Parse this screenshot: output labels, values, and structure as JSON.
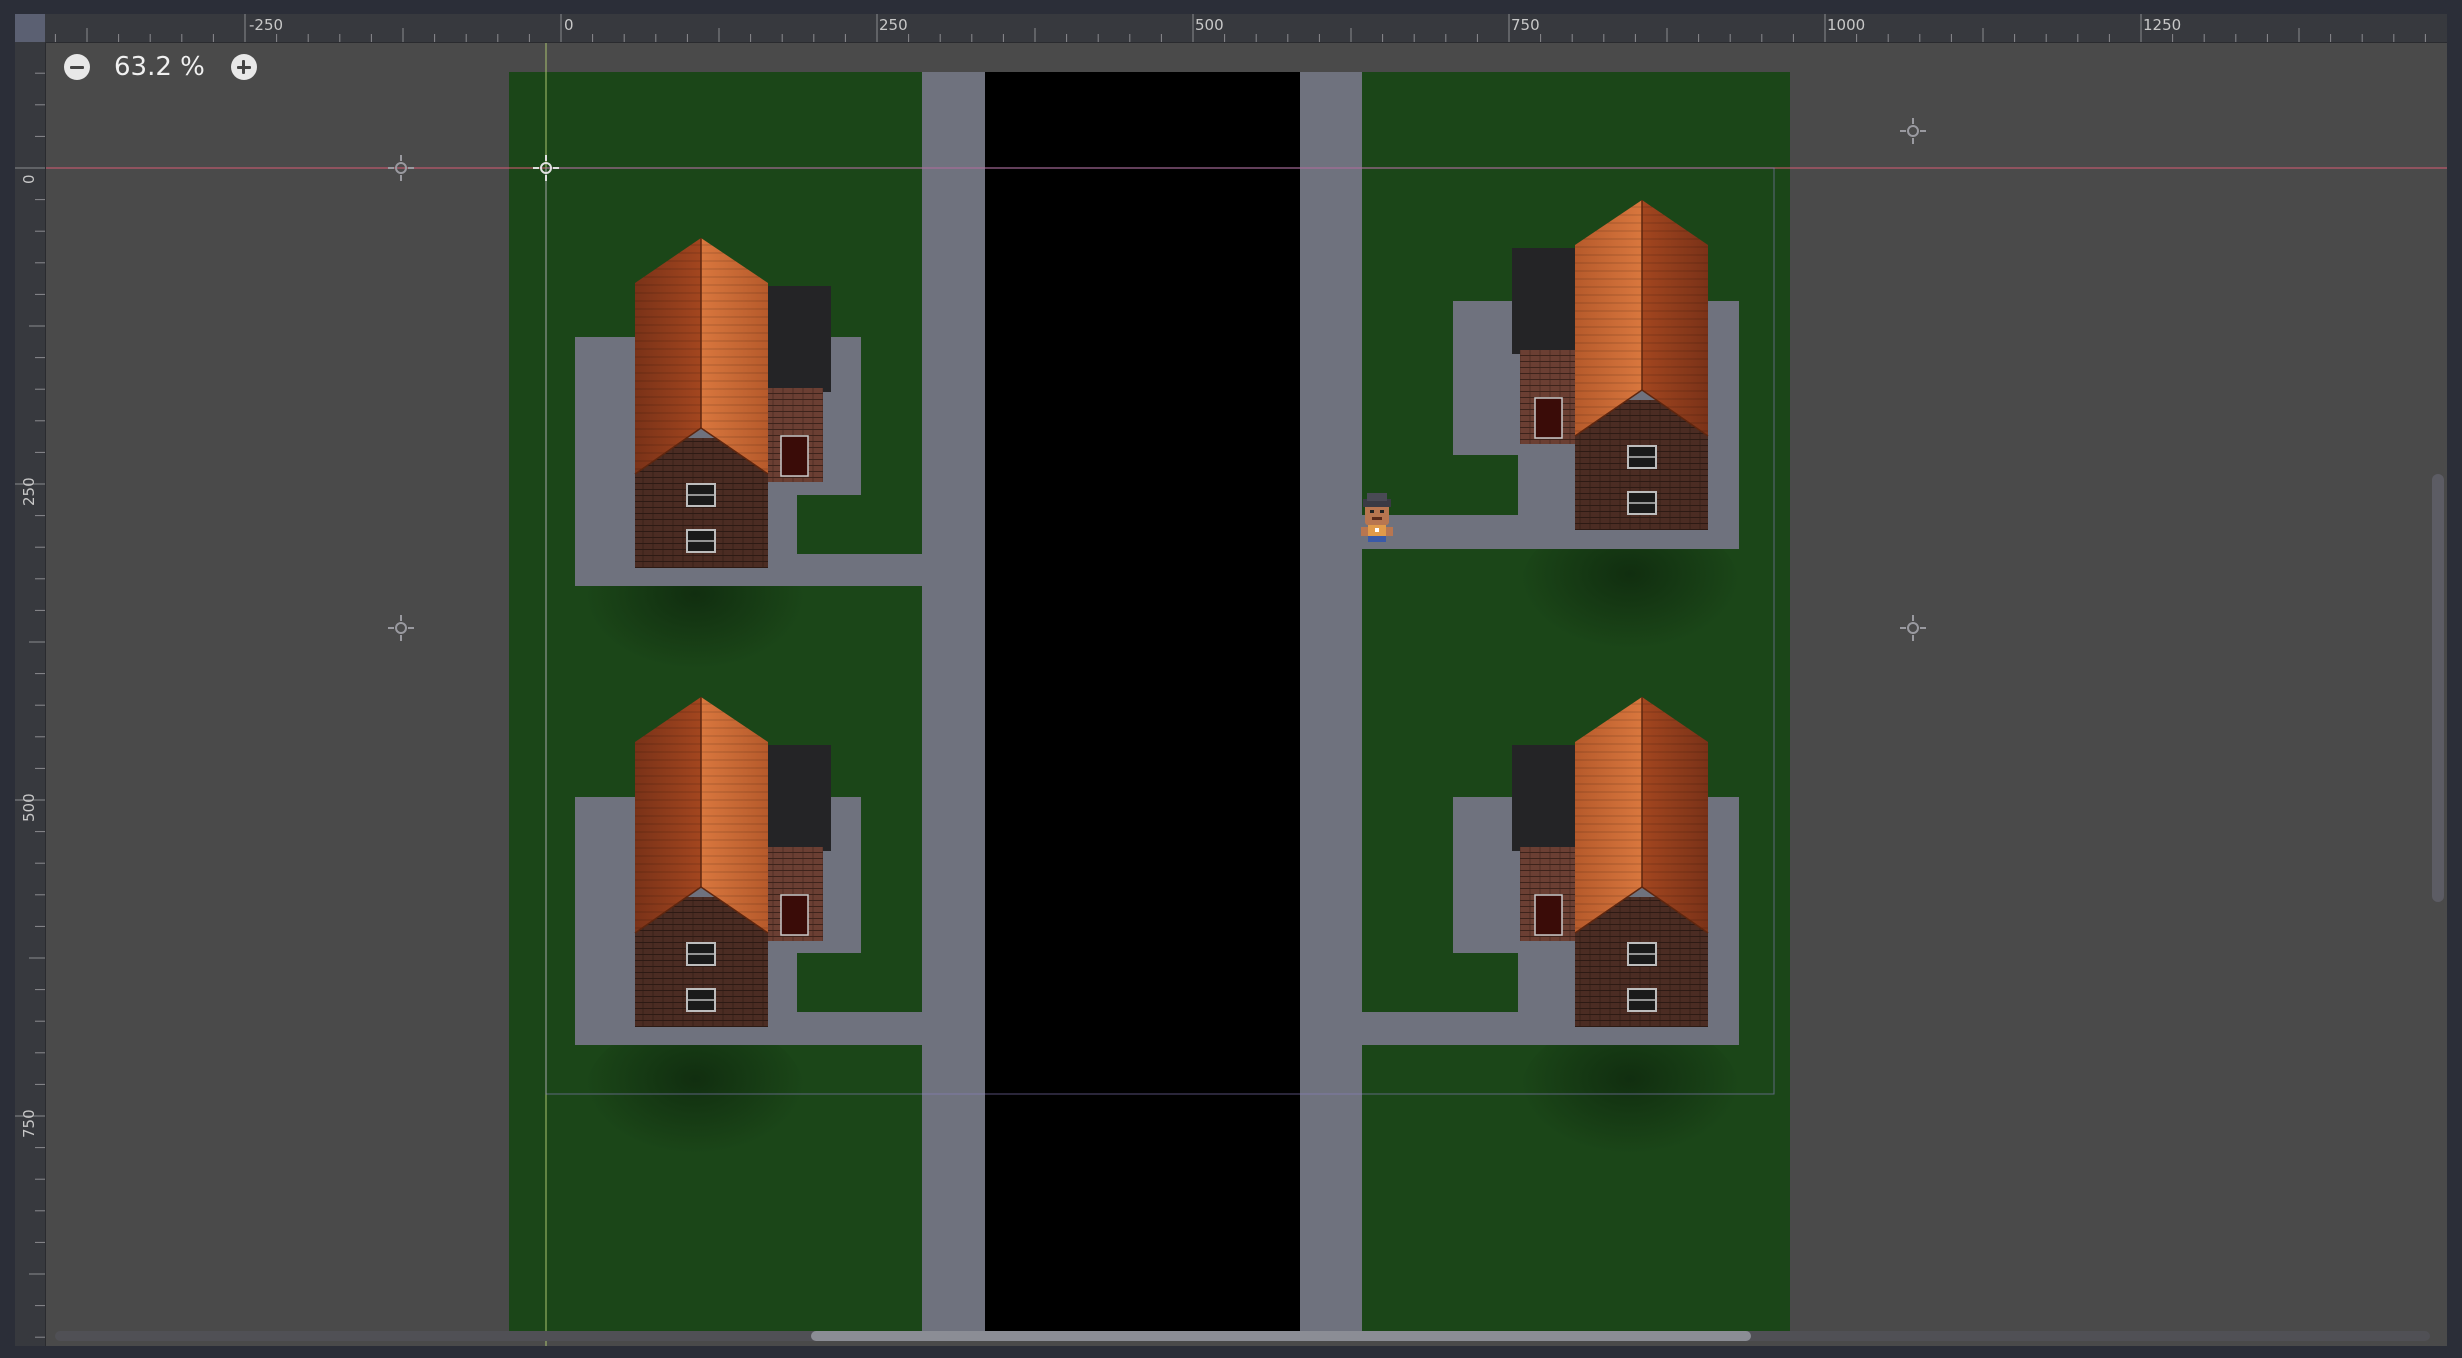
{
  "editor": {
    "zoom": {
      "label": "63.2 %",
      "zoom_out_icon": "minus-circle-icon",
      "zoom_in_icon": "plus-circle-icon"
    },
    "rulers": {
      "horizontal_labels": [
        "-250",
        "0",
        "250",
        "500",
        "750",
        "1000",
        "1250"
      ],
      "vertical_labels": [
        "0",
        "250",
        "500",
        "750"
      ]
    },
    "guide_colors": {
      "horizontal": "#cc5c72",
      "vertical": "#a7c06d",
      "viewport_rect": "#8a7fc1"
    },
    "camera_markers_icon": "crosshair-icon"
  },
  "scene": {
    "colors": {
      "grass": "#1a4417",
      "road": "#000000",
      "sidewalk": "#6e717d",
      "roof_light": "#c96a36",
      "roof_dark": "#8a3a1c",
      "brick": "#4a2c24",
      "chimney": "#2a2a2c"
    },
    "houses": [
      {
        "name": "house-top-left",
        "facing": "right"
      },
      {
        "name": "house-bottom-left",
        "facing": "right"
      },
      {
        "name": "house-top-right",
        "facing": "left"
      },
      {
        "name": "house-bottom-right",
        "facing": "left"
      }
    ],
    "player_icon": "character-sprite"
  }
}
